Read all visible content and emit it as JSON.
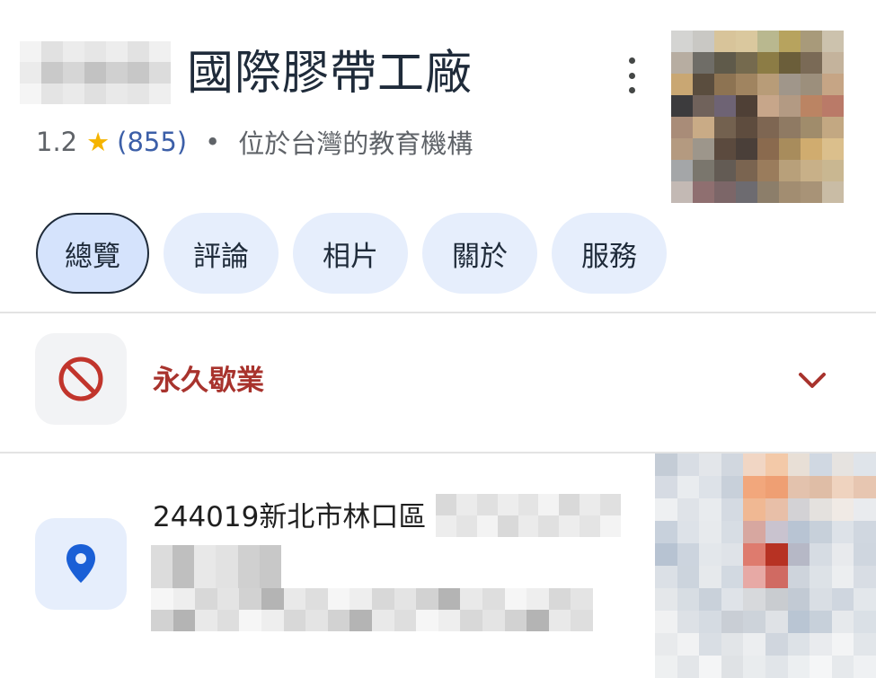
{
  "place": {
    "title": "國際膠帶工廠",
    "rating": "1.2",
    "star_glyph": "★",
    "review_count": "(855)",
    "separator": "•",
    "category": "位於台灣的教育機構"
  },
  "tabs": [
    {
      "label": "總覽",
      "active": true
    },
    {
      "label": "評論",
      "active": false
    },
    {
      "label": "相片",
      "active": false
    },
    {
      "label": "關於",
      "active": false
    },
    {
      "label": "服務",
      "active": false
    }
  ],
  "status": {
    "label": "永久歇業",
    "icon": "prohibited-icon",
    "expand_icon": "chevron-down-icon",
    "color": "#a8332d"
  },
  "address": {
    "visible_text": "244019新北市林口區",
    "icon": "map-pin-icon"
  },
  "colors": {
    "accent_blue": "#1a5fd6",
    "chip_bg": "#e6eefc",
    "chip_active_bg": "#d5e3fc",
    "star": "#f5b400",
    "closed_red": "#a8332d"
  }
}
